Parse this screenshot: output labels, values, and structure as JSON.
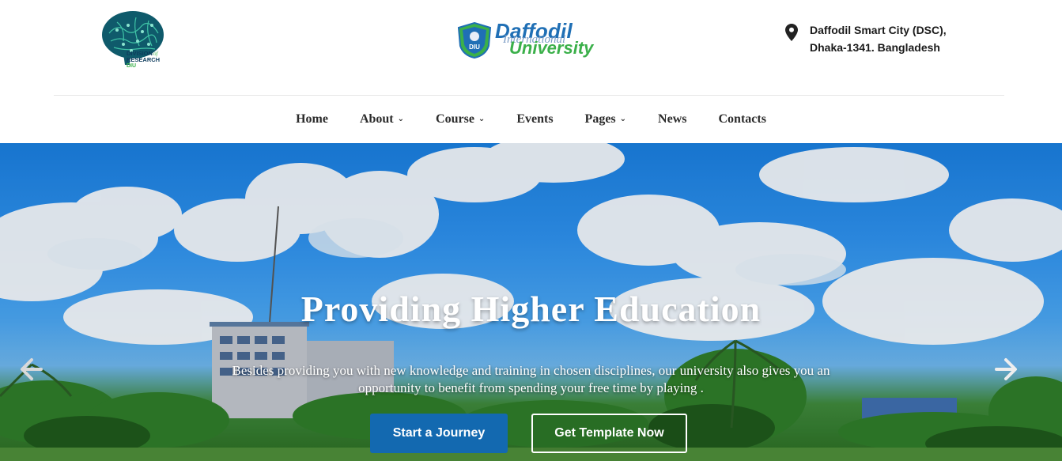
{
  "header": {
    "research_logo": {
      "name": "division-of-research-logo",
      "text_lines": [
        "DIVISION",
        "RESEARCH",
        "DIU"
      ],
      "text_of": "of"
    },
    "university_logo": {
      "line1": "Daffodil",
      "line2": "International",
      "line3": "University",
      "badge": "DIU"
    },
    "address": {
      "icon": "map-pin-icon",
      "line1": "Daffodil Smart City (DSC),",
      "line2": "Dhaka-1341. Bangladesh"
    }
  },
  "nav": {
    "items": [
      {
        "label": "Home",
        "dropdown": false
      },
      {
        "label": "About",
        "dropdown": true
      },
      {
        "label": "Course",
        "dropdown": true
      },
      {
        "label": "Events",
        "dropdown": false
      },
      {
        "label": "Pages",
        "dropdown": true
      },
      {
        "label": "News",
        "dropdown": false
      },
      {
        "label": "Contacts",
        "dropdown": false
      }
    ],
    "chevron": "⌄"
  },
  "hero": {
    "title": "Providing Higher Education",
    "subtitle": "Besides providing you with new knowledge and training in chosen disciplines, our university also gives you an opportunity to benefit from spending your free time by playing .",
    "primary_button": "Start a Journey",
    "secondary_button": "Get Template Now",
    "prev_icon": "arrow-left-icon",
    "next_icon": "arrow-right-icon"
  },
  "colors": {
    "primary_button": "#1369b0",
    "logo_blue": "#1f6fb5",
    "logo_green": "#3bb04a"
  }
}
